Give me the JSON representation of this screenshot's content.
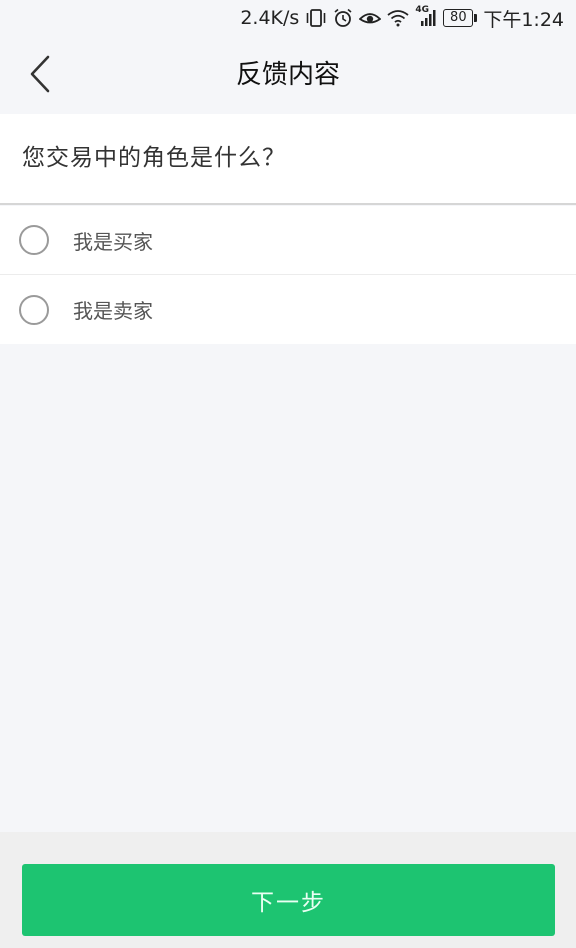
{
  "status_bar": {
    "speed": "2.4K/s",
    "network": "4G",
    "battery": "80",
    "time": "下午1:24",
    "icons": [
      "vibrate-icon",
      "alarm-icon",
      "eye-icon",
      "wifi-icon",
      "signal-icon",
      "battery-icon"
    ]
  },
  "header": {
    "title": "反馈内容",
    "back_icon": "chevron-left-icon"
  },
  "question": {
    "text": "您交易中的角色是什么？"
  },
  "options": [
    {
      "label": "我是买家",
      "selected": false
    },
    {
      "label": "我是卖家",
      "selected": false
    }
  ],
  "footer": {
    "next_label": "下一步",
    "button_color": "#1dc471"
  }
}
